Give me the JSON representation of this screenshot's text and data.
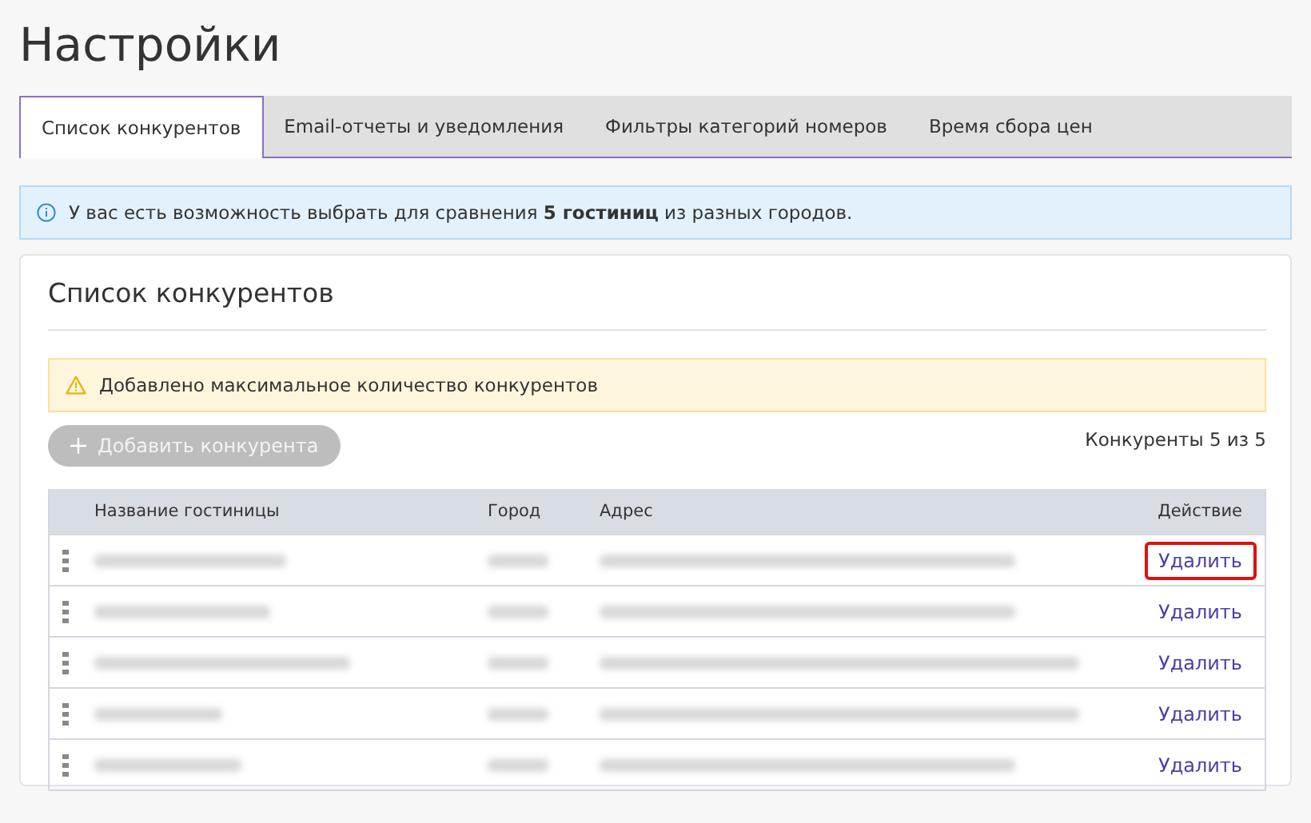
{
  "page_title": "Настройки",
  "tabs": [
    {
      "label": "Список конкурентов",
      "selected": true
    },
    {
      "label": "Email-отчеты и уведомления",
      "selected": false
    },
    {
      "label": "Фильтры категорий номеров",
      "selected": false
    },
    {
      "label": "Время сбора цен",
      "selected": false
    }
  ],
  "info_banner": "У вас есть возможность выбрать для сравнения **5 гостиниц** из разных городов.",
  "card": {
    "title": "Список конкурентов",
    "warning": "Добавлено максимальное количество конкурентов",
    "add_button": {
      "label": "Добавить конкурента",
      "disabled": true
    },
    "counter": "Конкуренты 5 из 5",
    "table": {
      "columns": [
        "Название гостиницы",
        "Город",
        "Адрес",
        "Действие"
      ],
      "rows": [
        {
          "action": "Удалить",
          "highlighted": true
        },
        {
          "action": "Удалить",
          "highlighted": false
        },
        {
          "action": "Удалить",
          "highlighted": false
        },
        {
          "action": "Удалить",
          "highlighted": false
        },
        {
          "action": "Удалить",
          "highlighted": false
        }
      ]
    }
  }
}
